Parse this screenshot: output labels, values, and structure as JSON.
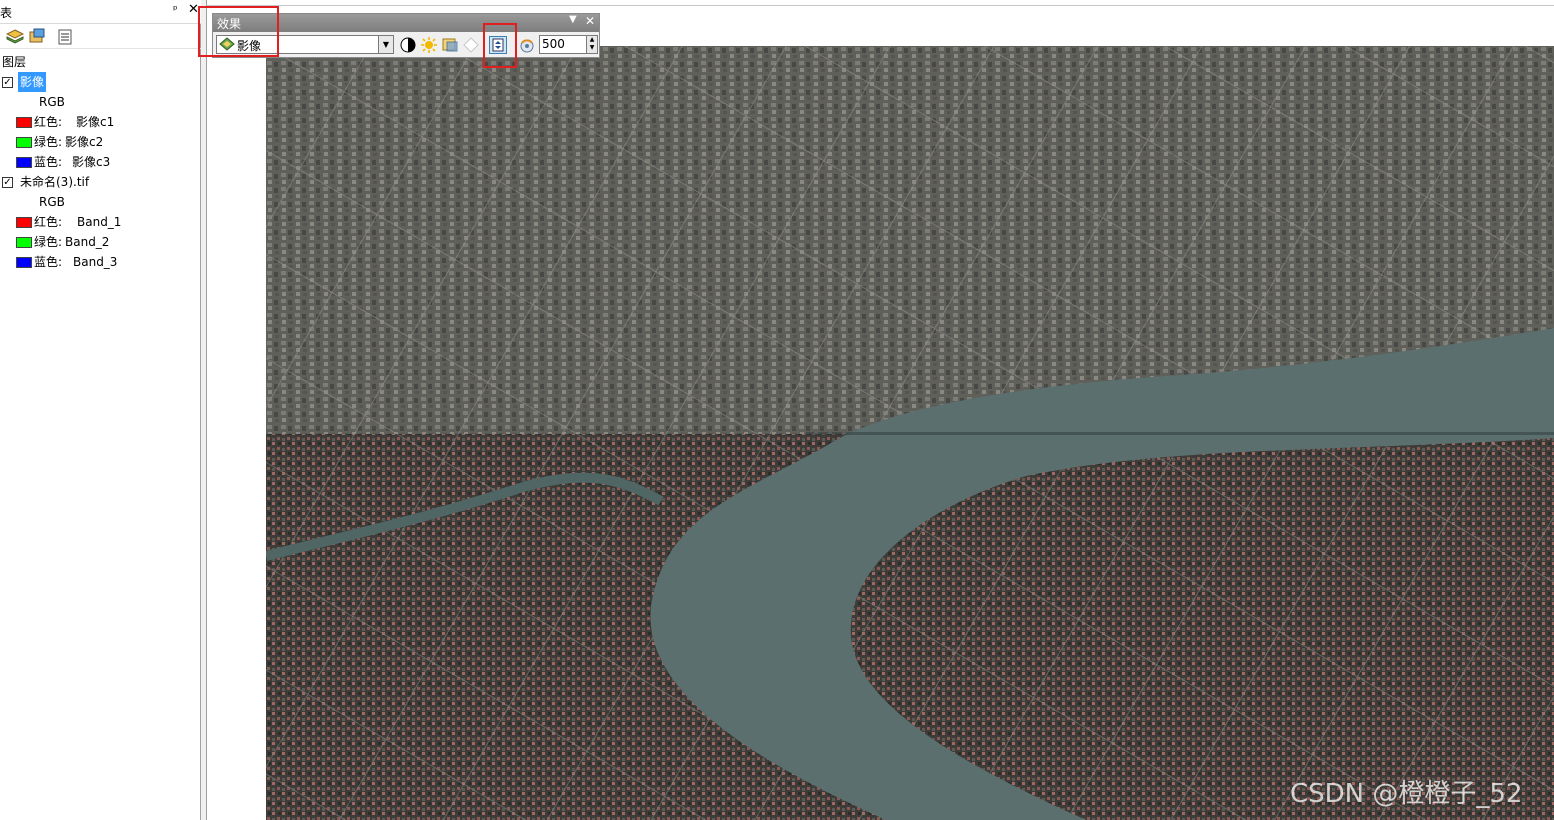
{
  "toc": {
    "title": "表",
    "layers_header": "图层",
    "layers": [
      {
        "name": "影像",
        "checked": true,
        "selected": true,
        "render_type": "RGB",
        "bands": [
          {
            "channel": "红色:",
            "band": "影像c1",
            "color": "#ff0000"
          },
          {
            "channel": "绿色:",
            "band": "影像c2",
            "color": "#00ff00"
          },
          {
            "channel": "蓝色:",
            "band": "影像c3",
            "color": "#0000ff"
          }
        ]
      },
      {
        "name": "未命名(3).tif",
        "checked": true,
        "selected": false,
        "render_type": "RGB",
        "bands": [
          {
            "channel": "红色:",
            "band": "Band_1",
            "color": "#ff0000"
          },
          {
            "channel": "绿色:",
            "band": "Band_2",
            "color": "#00ff00"
          },
          {
            "channel": "蓝色:",
            "band": "Band_3",
            "color": "#0000ff"
          }
        ]
      }
    ]
  },
  "effects": {
    "title": "效果",
    "layer": "影像",
    "flicker_rate": "500",
    "tools": [
      "contrast-icon",
      "brightness-icon",
      "transparency-icon",
      "swipe-icon",
      "flicker-icon"
    ]
  },
  "watermark": "CSDN @橙橙子_52",
  "colors": {
    "highlight": "#e02020",
    "selection": "#3399ff",
    "river": "#5b6f6e"
  }
}
